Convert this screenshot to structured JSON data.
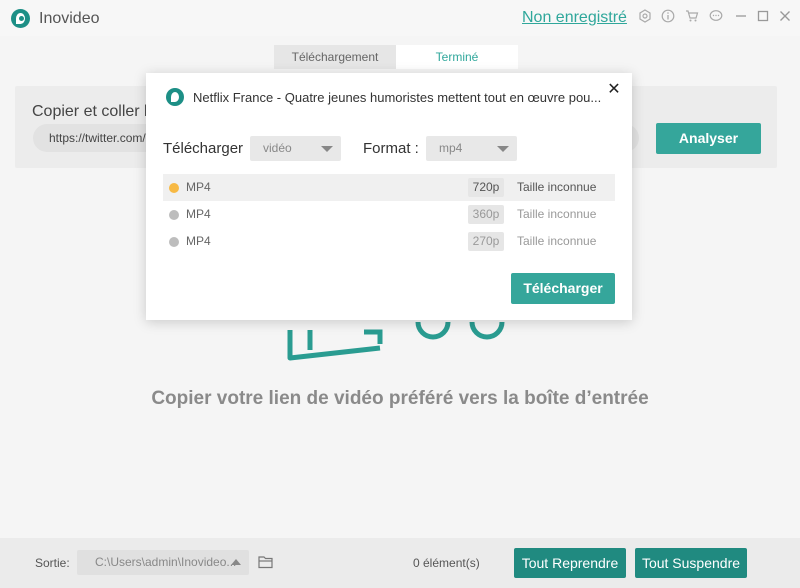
{
  "app": {
    "title": "Inovideo",
    "unregistered": "Non enregistré"
  },
  "tabs": [
    {
      "label": "Téléchargement"
    },
    {
      "label": "Terminé"
    }
  ],
  "main": {
    "copy_label": "Copier et coller l'",
    "url_value": "https://twitter.com/",
    "analyze_label": "Analyser",
    "empty_message": "Copier votre lien de vidéo préféré vers la boîte d’entrée"
  },
  "bottom": {
    "output_label": "Sortie:",
    "output_path": "C:\\Users\\admin\\Inovideo...",
    "count": "0 élément(s)",
    "resume_label": "Tout Reprendre",
    "suspend_label": "Tout Suspendre"
  },
  "dialog": {
    "title": "Netflix France - Quatre jeunes humoristes mettent tout en œuvre pou...",
    "close": "✕",
    "download_label": "Télécharger",
    "download_select": "vidéo",
    "format_label": "Format :",
    "format_select": "mp4",
    "options": [
      {
        "format": "MP4",
        "resolution": "720p",
        "size": "Taille inconnue",
        "selected": true
      },
      {
        "format": "MP4",
        "resolution": "360p",
        "size": "Taille inconnue",
        "selected": false
      },
      {
        "format": "MP4",
        "resolution": "270p",
        "size": "Taille inconnue",
        "selected": false
      }
    ],
    "download_button": "Télécharger"
  },
  "colors": {
    "accent": "#35a69b",
    "dark_accent": "#208a80",
    "selected_dot": "#f7b944"
  },
  "icons": [
    "settings-icon",
    "info-icon",
    "cart-icon",
    "chat-icon",
    "minimize-icon",
    "maximize-icon",
    "close-icon",
    "folder-icon"
  ]
}
